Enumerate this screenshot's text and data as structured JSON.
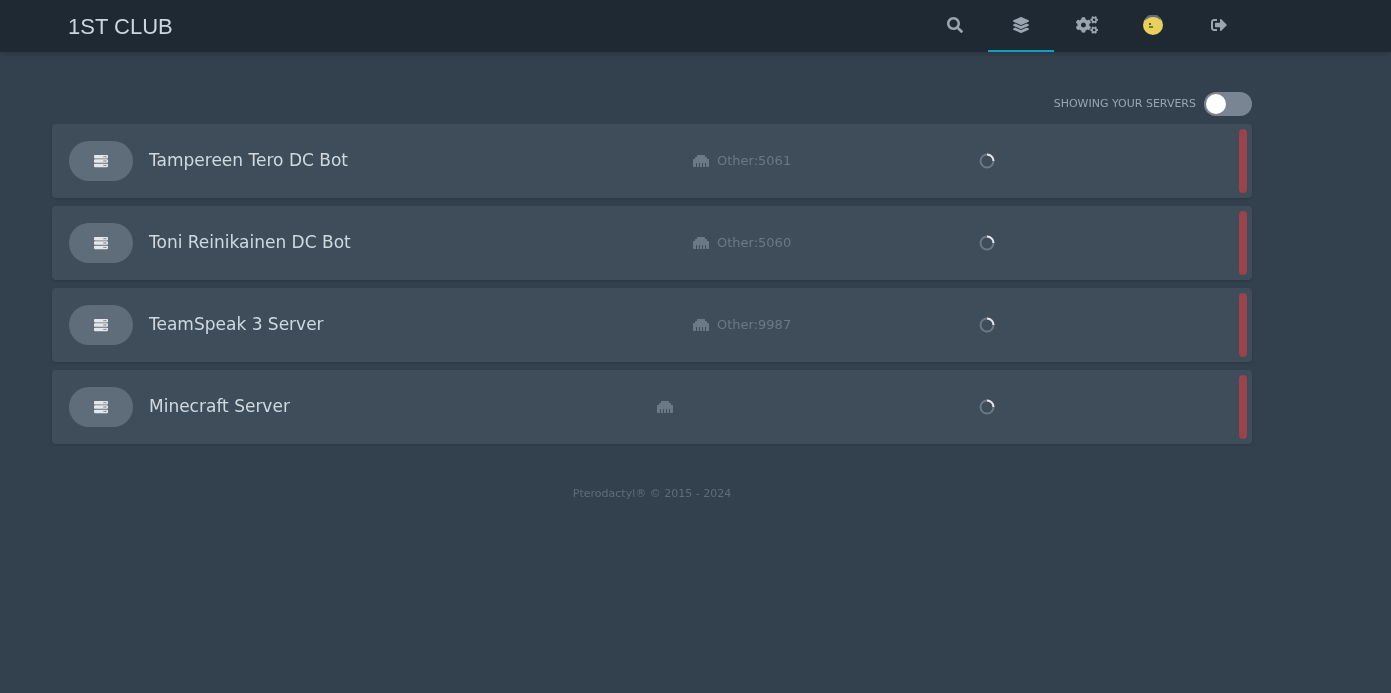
{
  "header": {
    "title": "1ST CLUB",
    "nav": [
      {
        "kind": "search",
        "selected": false
      },
      {
        "kind": "servers",
        "selected": true
      },
      {
        "kind": "admin",
        "selected": false
      },
      {
        "kind": "account",
        "selected": false
      },
      {
        "kind": "logout",
        "selected": false
      }
    ]
  },
  "filter": {
    "label": "SHOWING YOUR SERVERS",
    "on": false
  },
  "servers": [
    {
      "name": "Tampereen Tero DC Bot",
      "allocation": "Other:5061",
      "color": "#9b434b"
    },
    {
      "name": "Toni Reinikainen DC Bot",
      "allocation": "Other:5060",
      "color": "#9b434b"
    },
    {
      "name": "TeamSpeak 3 Server",
      "allocation": "Other:9987",
      "color": "#9b434b"
    },
    {
      "name": "Minecraft Server",
      "color": "#9b434b"
    }
  ],
  "footer": "Pterodactyl® © 2015 - 2024"
}
